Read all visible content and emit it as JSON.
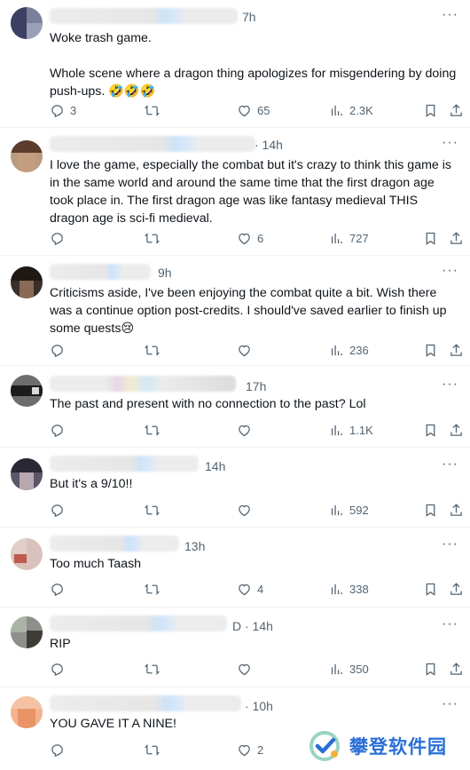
{
  "tweets": [
    {
      "time": "7h",
      "text": "Woke trash game.\n\nWhole scene where a dragon thing apologizes for misgendering by doing push-ups. 🤣🤣🤣",
      "replies": "3",
      "reposts": "",
      "likes": "65",
      "views": "2.3K"
    },
    {
      "time": "· 14h",
      "text": "I love the game, especially the combat but it's crazy to think this game is in the same world and around the same time that the first dragon age took place in. The first dragon age was like fantasy medieval THIS dragon age is sci-fi medieval.",
      "replies": "",
      "reposts": "",
      "likes": "6",
      "views": "727"
    },
    {
      "time": "9h",
      "text": "Criticisms aside, I've been enjoying the combat quite a bit. Wish there was a continue option post-credits. I should've saved earlier to finish up some quests😢",
      "replies": "",
      "reposts": "",
      "likes": "",
      "views": "236"
    },
    {
      "time": "17h",
      "text": "The past and present with no connection to the past? Lol",
      "replies": "",
      "reposts": "",
      "likes": "",
      "views": "1.1K"
    },
    {
      "time": "14h",
      "text": "But it's a 9/10!!",
      "replies": "",
      "reposts": "",
      "likes": "",
      "views": "592"
    },
    {
      "time": "13h",
      "text": "Too much Taash",
      "replies": "",
      "reposts": "",
      "likes": "4",
      "views": "338"
    },
    {
      "time": "D · 14h",
      "text": "RIP",
      "replies": "",
      "reposts": "",
      "likes": "",
      "views": "350"
    },
    {
      "time": "· 10h",
      "text": "YOU GAVE IT A NINE!",
      "replies": "",
      "reposts": "",
      "likes": "2",
      "views": ""
    }
  ],
  "more_icon": "···",
  "watermark": {
    "text": "攀登软件园"
  }
}
